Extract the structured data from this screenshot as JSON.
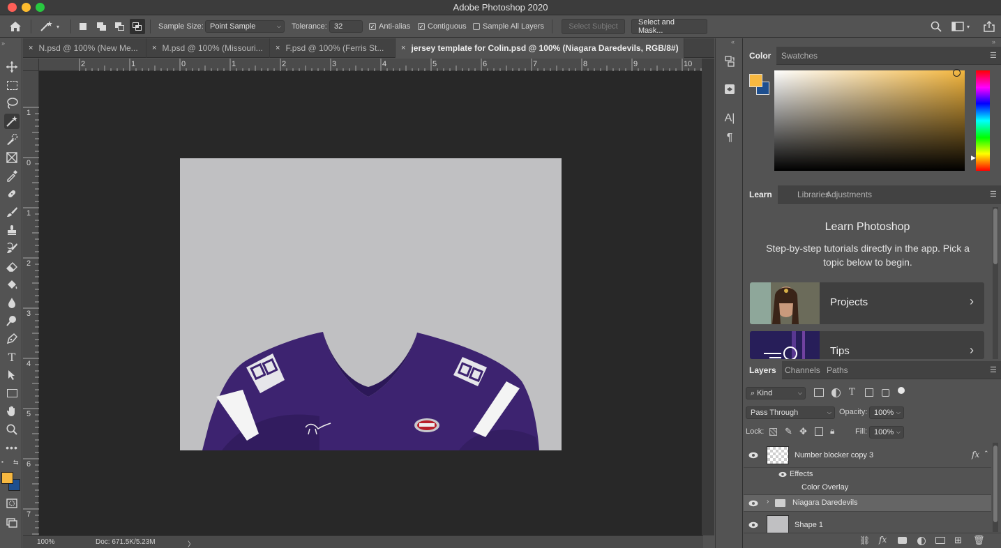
{
  "app": {
    "title": "Adobe Photoshop 2020"
  },
  "options_bar": {
    "sample_size_label": "Sample Size:",
    "sample_size_value": "Point Sample",
    "tolerance_label": "Tolerance:",
    "tolerance_value": "32",
    "anti_alias": {
      "label": "Anti-alias",
      "checked": true
    },
    "contiguous": {
      "label": "Contiguous",
      "checked": true
    },
    "sample_all_layers": {
      "label": "Sample All Layers",
      "checked": false
    },
    "select_subject": "Select Subject",
    "select_and_mask": "Select and Mask..."
  },
  "doc_tabs": [
    {
      "label": "N.psd @ 100% (New Me...",
      "close": "×"
    },
    {
      "label": "M.psd @ 100% (Missouri...",
      "close": "×"
    },
    {
      "label": "F.psd @ 100% (Ferris St...",
      "close": "×"
    },
    {
      "label": "jersey template for Colin.psd @ 100% (Niagara Daredevils, RGB/8#)",
      "close": "×"
    }
  ],
  "ruler_h_labels": [
    "2",
    "1",
    "0",
    "1",
    "2",
    "3",
    "4",
    "5",
    "6",
    "7",
    "8",
    "9",
    "10"
  ],
  "ruler_v_labels": [
    "1",
    "0",
    "1",
    "2",
    "3",
    "4",
    "5",
    "6",
    "7"
  ],
  "status_bar": {
    "zoom": "100%",
    "doc": "Doc: 671.5K/5.23M",
    "arrow": "〉"
  },
  "color_panel": {
    "tabs": [
      "Color",
      "Swatches"
    ],
    "foreground": "#f7b840",
    "background": "#1e4f8f",
    "hue_color": "#f3b63e"
  },
  "learn_panel": {
    "tabs": [
      "Learn",
      "Libraries",
      "Adjustments"
    ],
    "heading": "Learn Photoshop",
    "subtitle": "Step-by-step tutorials directly in the app. Pick a topic below to begin.",
    "cards": [
      {
        "label": "Projects",
        "arrow": "›"
      },
      {
        "label": "Tips",
        "arrow": "›"
      }
    ]
  },
  "layers_panel": {
    "tabs": [
      "Layers",
      "Channels",
      "Paths"
    ],
    "filter": "Kind",
    "blend_mode": "Pass Through",
    "opacity_label": "Opacity:",
    "opacity_value": "100%",
    "lock_label": "Lock:",
    "fill_label": "Fill:",
    "fill_value": "100%",
    "layers": [
      {
        "name": "Number blocker copy 3",
        "fx": "fx"
      },
      {
        "name": "Effects"
      },
      {
        "name": "Color Overlay"
      },
      {
        "name": "Niagara Daredevils"
      },
      {
        "name": "Shape 1"
      }
    ]
  },
  "tools": [
    "move-tool",
    "marquee-tool",
    "lasso-tool",
    "magic-wand-tool",
    "quick-selection-tool",
    "frame-tool",
    "eyedropper-tool",
    "healing-brush-tool",
    "brush-tool",
    "clone-stamp-tool",
    "history-brush-tool",
    "eraser-tool",
    "paint-bucket-tool",
    "blur-tool",
    "dodge-tool",
    "pen-tool",
    "type-tool",
    "path-selection-tool",
    "rectangle-tool",
    "hand-tool",
    "zoom-tool",
    "more-tools"
  ]
}
